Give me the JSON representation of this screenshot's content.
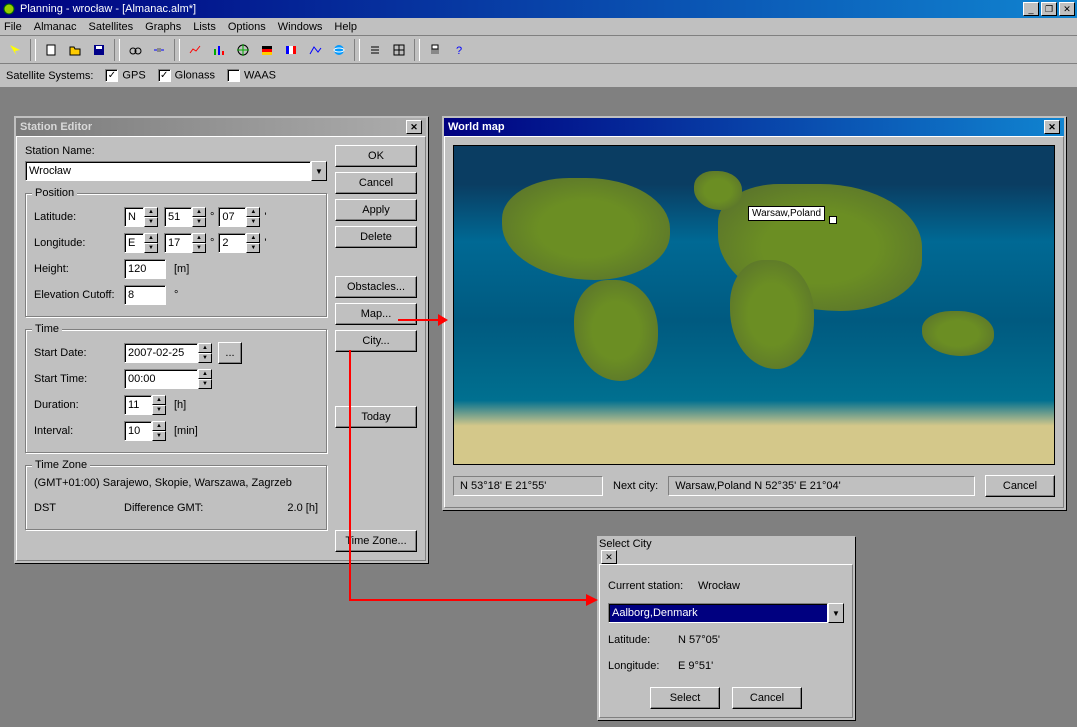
{
  "app": {
    "title": "Planning - wrocław - [Almanac.alm*]"
  },
  "menu": {
    "file": "File",
    "almanac": "Almanac",
    "satellites": "Satellites",
    "graphs": "Graphs",
    "lists": "Lists",
    "options": "Options",
    "windows": "Windows",
    "help": "Help"
  },
  "satbar": {
    "label": "Satellite Systems:",
    "gps": "GPS",
    "glonass": "Glonass",
    "waas": "WAAS"
  },
  "editor": {
    "title": "Station Editor",
    "station_name_label": "Station Name:",
    "station_name": "Wrocław",
    "position_legend": "Position",
    "latitude_label": "Latitude:",
    "lat_hemi": "N",
    "lat_deg": "51",
    "lat_min": "07",
    "longitude_label": "Longitude:",
    "lon_hemi": "E",
    "lon_deg": "17",
    "lon_min": "2",
    "height_label": "Height:",
    "height": "120",
    "height_unit": "[m]",
    "elev_label": "Elevation Cutoff:",
    "elev": "8",
    "elev_unit": "°",
    "deg_sym": "°",
    "min_sym": "'",
    "time_legend": "Time",
    "start_date_label": "Start Date:",
    "start_date": "2007-02-25",
    "ellipsis": "...",
    "start_time_label": "Start Time:",
    "start_time": "00:00",
    "duration_label": "Duration:",
    "duration": "11",
    "duration_unit": "[h]",
    "interval_label": "Interval:",
    "interval": "10",
    "interval_unit": "[min]",
    "tz_legend": "Time Zone",
    "tz_text": "(GMT+01:00) Sarajewo, Skopie, Warszawa, Zagrzeb",
    "dst": "DST",
    "diff_label": "Difference GMT:",
    "diff_val": "2.0   [h]",
    "btn_ok": "OK",
    "btn_cancel": "Cancel",
    "btn_apply": "Apply",
    "btn_delete": "Delete",
    "btn_obstacles": "Obstacles...",
    "btn_map": "Map...",
    "btn_city": "City...",
    "btn_today": "Today",
    "btn_timezone": "Time Zone..."
  },
  "worldmap": {
    "title": "World map",
    "pin_label": "Warsaw,Poland",
    "coord": "N  53°18'   E  21°55'",
    "next_label": "Next city:",
    "next_city": "Warsaw,Poland  N  52°35'   E 21°04'",
    "cancel": "Cancel"
  },
  "selectcity": {
    "title": "Select City",
    "current_label": "Current station:",
    "current_val": "Wrocław",
    "combo_val": "Aalborg,Denmark",
    "lat_label": "Latitude:",
    "lat_val": "N  57°05'",
    "lon_label": "Longitude:",
    "lon_val": "E  9°51'",
    "select": "Select",
    "cancel": "Cancel"
  }
}
